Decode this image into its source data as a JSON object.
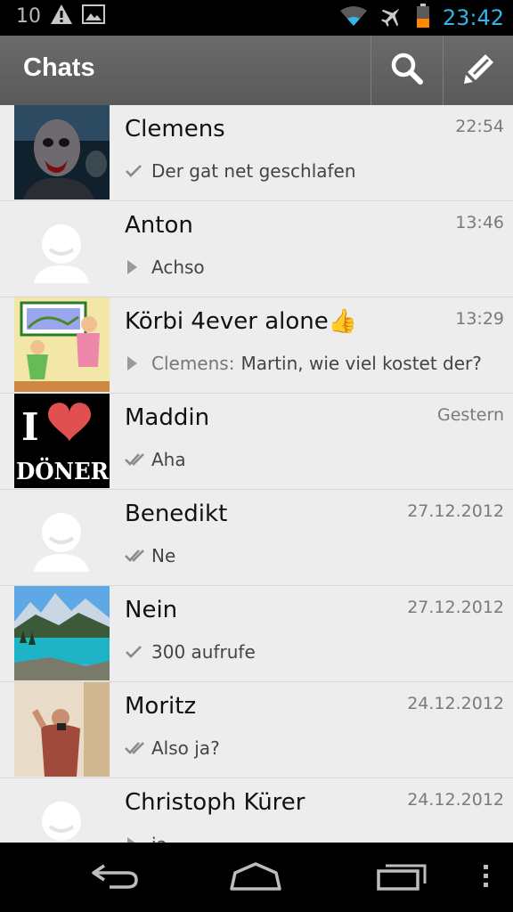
{
  "status_bar": {
    "notification_count": "10",
    "time": "23:42"
  },
  "action_bar": {
    "title": "Chats"
  },
  "chats": [
    {
      "name": "Clemens",
      "time": "22:54",
      "sender": "",
      "message": "Der gat net geschlafen",
      "status": "sent",
      "avatar": "zombie"
    },
    {
      "name": "Anton",
      "time": "13:46",
      "sender": "",
      "message": "Achso",
      "status": "received",
      "avatar": "default"
    },
    {
      "name": "Körbi 4ever alone👍",
      "time": "13:29",
      "sender": "Clemens:",
      "message": "Martin, wie viel kostet der?",
      "status": "received",
      "avatar": "cartoon"
    },
    {
      "name": "Maddin",
      "time": "Gestern",
      "sender": "",
      "message": "Aha",
      "status": "delivered",
      "avatar": "doner"
    },
    {
      "name": "Benedikt",
      "time": "27.12.2012",
      "sender": "",
      "message": "Ne",
      "status": "delivered",
      "avatar": "default"
    },
    {
      "name": "Nein",
      "time": "27.12.2012",
      "sender": "",
      "message": "300 aufrufe",
      "status": "sent",
      "avatar": "lake"
    },
    {
      "name": "Moritz",
      "time": "24.12.2012",
      "sender": "",
      "message": "Also ja?",
      "status": "delivered",
      "avatar": "person"
    },
    {
      "name": "Christoph Kürer",
      "time": "24.12.2012",
      "sender": "",
      "message": "ja",
      "status": "received",
      "avatar": "default"
    }
  ],
  "doner_avatar": {
    "word_top": "I",
    "word_bottom": "DÖNER"
  },
  "icons": [
    "warning-icon",
    "image-icon",
    "wifi-icon",
    "airplane-icon",
    "battery-icon",
    "search-icon",
    "compose-icon",
    "back-icon",
    "home-icon",
    "recent-apps-icon",
    "overflow-menu-icon"
  ],
  "colors": {
    "time_accent": "#33b5e5",
    "action_bar": "#5f5f5f",
    "list_bg": "#ededed"
  }
}
